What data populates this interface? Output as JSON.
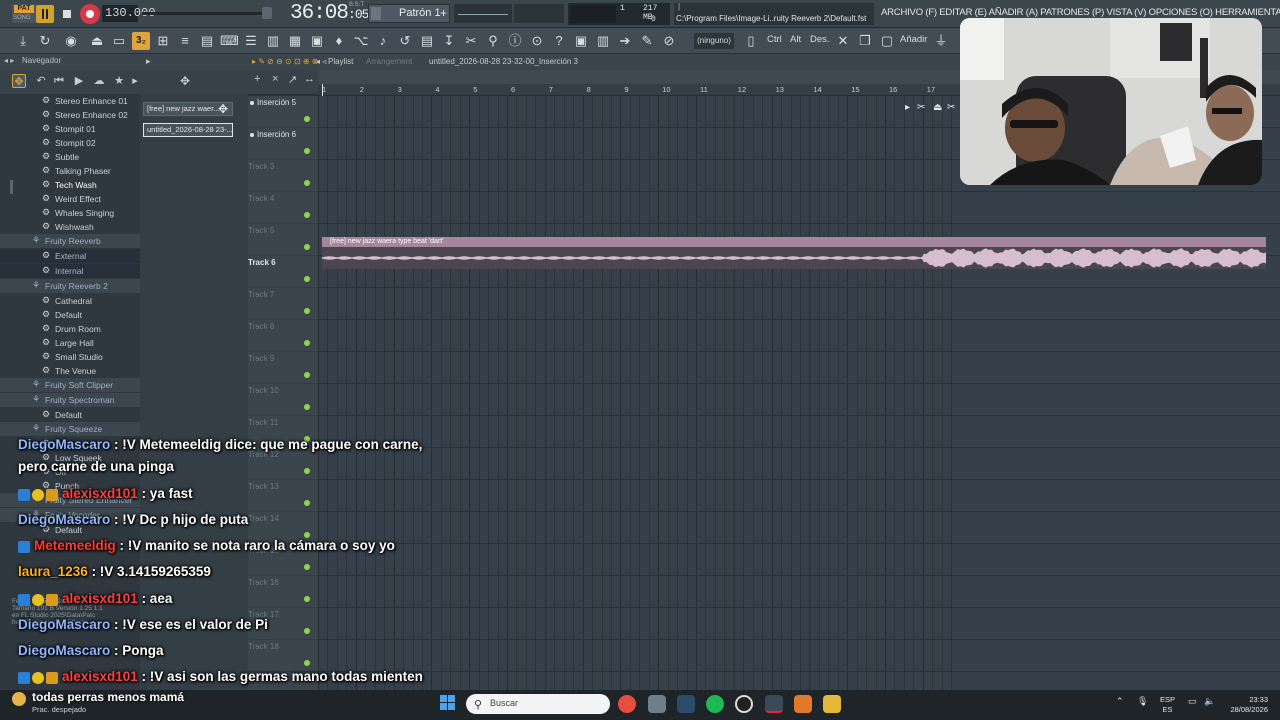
{
  "transport": {
    "pat_label": "PAT",
    "song_label": "SONG",
    "tempo": "130.000",
    "time_main": "36:08",
    "time_sub": ":05",
    "time_unit": "B:S:T",
    "pattern_name": "Patrón 1",
    "pattern_add": "+",
    "cpu_value": "1",
    "mem_value": "217 MB",
    "poly_value": "0",
    "hint_path": "C:\\Program Files\\Image-Li..ruity Reeverb 2\\Default.fst",
    "hint_top": "|"
  },
  "menu": {
    "text": "ARCHIVO (F) EDITAR (E) AÑADIR (A) PATRONES (P) VISTA (V) OPCIONES (O) HERRAMIENTAS (T) AYUDA"
  },
  "toolbar": {
    "snap_label": "3₂",
    "preset": "(ninguno)",
    "ctrl": "Ctrl",
    "alt": "Alt",
    "des": "Des.",
    "anadir": "Añadir"
  },
  "navigator": {
    "title": "Navegador",
    "items": [
      {
        "label": "Stereo Enhance 01",
        "kind": "preset"
      },
      {
        "label": "Stereo Enhance 02",
        "kind": "preset"
      },
      {
        "label": "Stompit 01",
        "kind": "preset"
      },
      {
        "label": "Stompit 02",
        "kind": "preset"
      },
      {
        "label": "Subtle",
        "kind": "preset"
      },
      {
        "label": "Talking Phaser",
        "kind": "preset"
      },
      {
        "label": "Tech Wash",
        "kind": "preset"
      },
      {
        "label": "Weird Effect",
        "kind": "preset"
      },
      {
        "label": "Whales Singing",
        "kind": "preset"
      },
      {
        "label": "Wishwash",
        "kind": "preset"
      },
      {
        "label": "Fruity Reeverb",
        "kind": "folder"
      },
      {
        "label": "External",
        "kind": "sub"
      },
      {
        "label": "Internal",
        "kind": "sub"
      },
      {
        "label": "Fruity Reeverb 2",
        "kind": "folder"
      },
      {
        "label": "Cathedral",
        "kind": "preset"
      },
      {
        "label": "Default",
        "kind": "preset"
      },
      {
        "label": "Drum Room",
        "kind": "preset"
      },
      {
        "label": "Large Hall",
        "kind": "preset"
      },
      {
        "label": "Small Studio",
        "kind": "preset"
      },
      {
        "label": "The Venue",
        "kind": "preset"
      },
      {
        "label": "Fruity Soft Clipper",
        "kind": "folder"
      },
      {
        "label": "Fruity Spectroman",
        "kind": "folder"
      },
      {
        "label": "Default",
        "kind": "preset"
      },
      {
        "label": "Fruity Squeeze",
        "kind": "folder"
      },
      {
        "label": "Grit",
        "kind": "preset"
      },
      {
        "label": "Low Squeek",
        "kind": "preset"
      },
      {
        "label": "Off",
        "kind": "preset"
      },
      {
        "label": "Punch",
        "kind": "preset"
      },
      {
        "label": "Fruity Stereo Enhancer",
        "kind": "folder"
      },
      {
        "label": "Fruity Vocoder",
        "kind": "folder"
      },
      {
        "label": "Default",
        "kind": "preset"
      }
    ],
    "footer": [
      "Fecha 2025 03 28 48",
      "Tamaño 191 B  Versión 1.25 1.1",
      "en FL Studio 2025\\Data\\Patc",
      "hes\\Plugin presets\\Effects"
    ]
  },
  "picker": {
    "items": [
      "[free] new jazz  waer...",
      "untitled_2026-08-28 23-..."
    ]
  },
  "playlist": {
    "title": "Playlist",
    "breadcrumb_1": "Arrangement",
    "breadcrumb_2": "untitled_2026-08-28 23-32-00_Inserción 3",
    "ruler": [
      "1",
      "2",
      "3",
      "4",
      "5",
      "6",
      "7",
      "8",
      "9",
      "10",
      "11",
      "12",
      "13",
      "14",
      "15",
      "16",
      "17"
    ],
    "tracks": [
      {
        "label": "Inserción 5",
        "active": true
      },
      {
        "label": "Inserción 6",
        "active": true
      },
      {
        "label": "Track 3",
        "active": false
      },
      {
        "label": "Track 4",
        "active": false
      },
      {
        "label": "Track 5",
        "active": false
      },
      {
        "label": "Track 6",
        "active": true
      },
      {
        "label": "Track 7",
        "active": false
      },
      {
        "label": "Track 8",
        "active": false
      },
      {
        "label": "Track 9",
        "active": false
      },
      {
        "label": "Track 10",
        "active": false
      },
      {
        "label": "Track 11",
        "active": false
      },
      {
        "label": "Track 12",
        "active": false
      },
      {
        "label": "Track 13",
        "active": false
      },
      {
        "label": "Track 14",
        "active": false
      },
      {
        "label": "Track 15",
        "active": false
      },
      {
        "label": "Track 16",
        "active": false
      },
      {
        "label": "Track 17",
        "active": false
      },
      {
        "label": "Track 18",
        "active": false
      },
      {
        "label": "Track 19",
        "active": false
      }
    ],
    "clip_title": "[free] new jazz  waera type beat  'dart'"
  },
  "chat": {
    "messages": [
      {
        "user": "DiegoMascaro",
        "color": "#8fb6ff",
        "badges": 0,
        "text": " : !V Metemeeldig dice: que me pague con carne,"
      },
      {
        "user": "",
        "color": "#ffffff",
        "badges": 0,
        "text": "pero carne de una pinga",
        "cont": true
      },
      {
        "user": "alexisxd101",
        "color": "#ff4040",
        "badges": 3,
        "text": " : ya fast"
      },
      {
        "user": "DiegoMascaro",
        "color": "#8fb6ff",
        "badges": 0,
        "text": " : !V Dc p hijo de puta"
      },
      {
        "user": "Metemeeldig",
        "color": "#ff3b30",
        "badges": 1,
        "text": " : !V manito se nota raro la cámara o soy yo"
      },
      {
        "user": "laura_1236",
        "color": "#ffb01f",
        "badges": 0,
        "text": " : !V 3.14159265359"
      },
      {
        "user": "alexisxd101",
        "color": "#ff4040",
        "badges": 3,
        "text": " : aea"
      },
      {
        "user": "DiegoMascaro",
        "color": "#8fb6ff",
        "badges": 0,
        "text": " : !V ese es el valor de Pi"
      },
      {
        "user": "DiegoMascaro",
        "color": "#8fb6ff",
        "badges": 0,
        "text": " : Ponga"
      },
      {
        "user": "alexisxd101",
        "color": "#ff4040",
        "badges": 3,
        "text": " : !V asi son las germas mano todas mienten"
      }
    ],
    "last_line": "todas perras menos mamá"
  },
  "taskbar": {
    "weather": "Prac. despejado",
    "search_placeholder": "Buscar",
    "lang_1": "ESP",
    "lang_2": "ES",
    "time": "23:33",
    "date": "28/08/2026"
  },
  "colors": {
    "accent": "#e0a43a",
    "clip": "#cfb6c8",
    "grid": "#35404a"
  }
}
